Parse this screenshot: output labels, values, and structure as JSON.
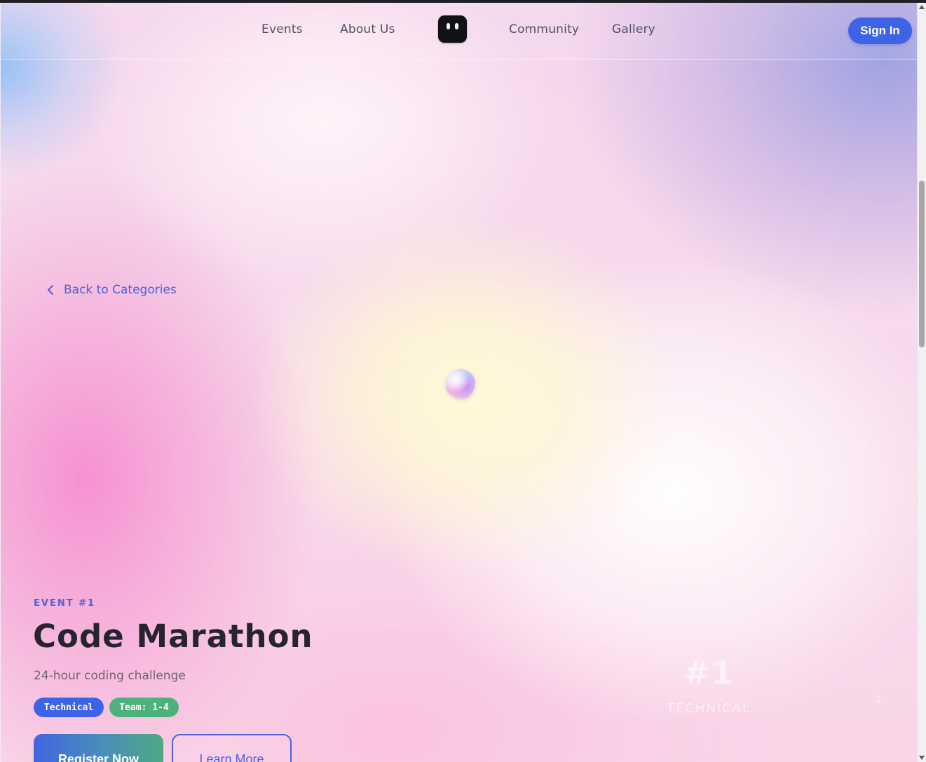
{
  "nav": {
    "links": [
      "Events",
      "About Us",
      "Community",
      "Gallery"
    ],
    "signin_label": "Sign In"
  },
  "back_link": {
    "label": "Back to Categories"
  },
  "event": {
    "eyebrow": "EVENT #1",
    "title": "Code Marathon",
    "subtitle": "24-hour coding challenge",
    "tags": [
      "Technical",
      "Team: 1-4"
    ],
    "primary_cta": "Register Now",
    "secondary_cta": "Learn More"
  },
  "badge": {
    "number": "#1",
    "label": "TECHNICAL",
    "arrow": "↓"
  },
  "colors": {
    "accent": "#3f63e6",
    "accent_text": "#4b62dc",
    "team_tag": "#4cb17c",
    "title_text": "#25242f"
  },
  "icons": {
    "back": "chevron-left-icon",
    "logo": "robot-face-logo",
    "scroll": "arrow-down-icon"
  }
}
